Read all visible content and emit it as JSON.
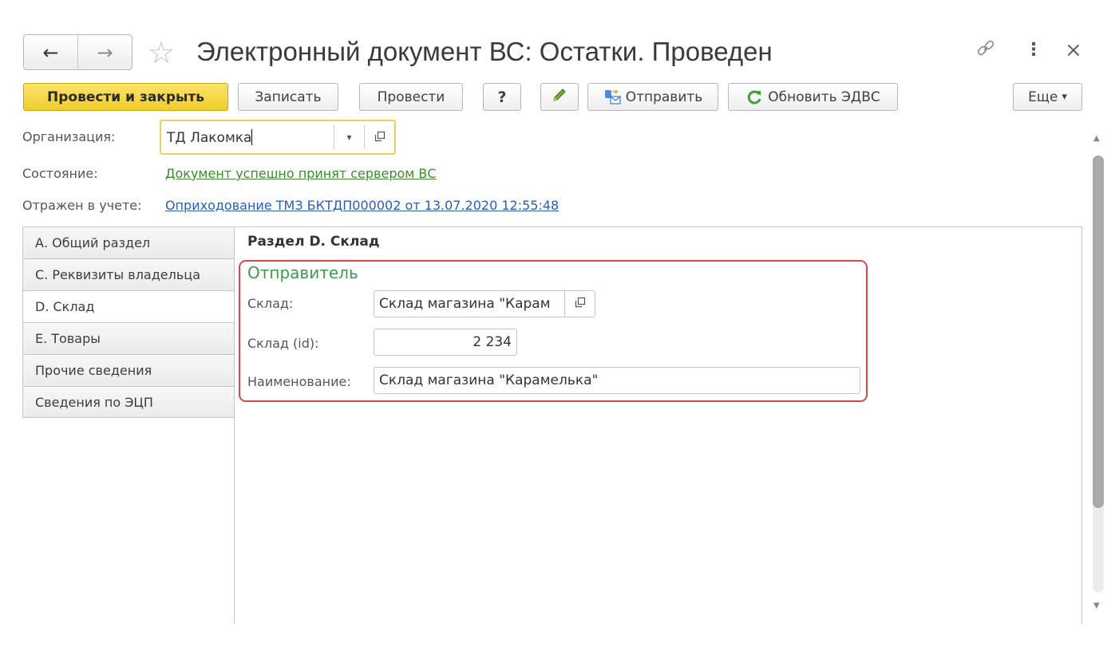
{
  "header": {
    "title": "Электронный документ ВС: Остатки. Проведен",
    "back_icon": "←",
    "forward_icon": "→",
    "star_icon": "☆",
    "more_icon": "⋮",
    "close_icon": "×"
  },
  "toolbar": {
    "post_close": "Провести и закрыть",
    "save": "Записать",
    "post": "Провести",
    "help": "?",
    "send": "Отправить",
    "refresh": "Обновить ЭДВС",
    "more": "Еще",
    "more_arrow": "▾"
  },
  "fields": {
    "org_label": "Организация:",
    "org_value": "ТД Лакомка",
    "dropdown_arrow": "▾",
    "state_label": "Состояние:",
    "state_value": "Документ успешно принят сервером ВС",
    "reflected_label": "Отражен в учете:",
    "reflected_value": "Оприходование ТМЗ БКТДП000002 от 13.07.2020 12:55:48"
  },
  "tabs": [
    {
      "label": "А. Общий раздел"
    },
    {
      "label": "С. Реквизиты владельца"
    },
    {
      "label": "D. Склад"
    },
    {
      "label": "Е. Товары"
    },
    {
      "label": "Прочие сведения"
    },
    {
      "label": "Сведения по ЭЦП"
    }
  ],
  "section": {
    "title": "Раздел D. Склад",
    "group_title": "Отправитель",
    "warehouse_label": "Склад:",
    "warehouse_value": "Склад магазина \"Карам",
    "warehouse_id_label": "Склад (id):",
    "warehouse_id_value": "2 234",
    "name_label": "Наименование:",
    "name_value": "Склад магазина \"Карамелька\""
  },
  "scrollbar": {
    "up": "▲",
    "down": "▼"
  },
  "colors": {
    "primary_button": "#f0cd2c",
    "focus_border": "#f0cf52",
    "link_green": "#3f8a2e",
    "link_blue": "#2a5db5",
    "highlight_box": "#d94848",
    "group_title": "#3f9a4e"
  }
}
